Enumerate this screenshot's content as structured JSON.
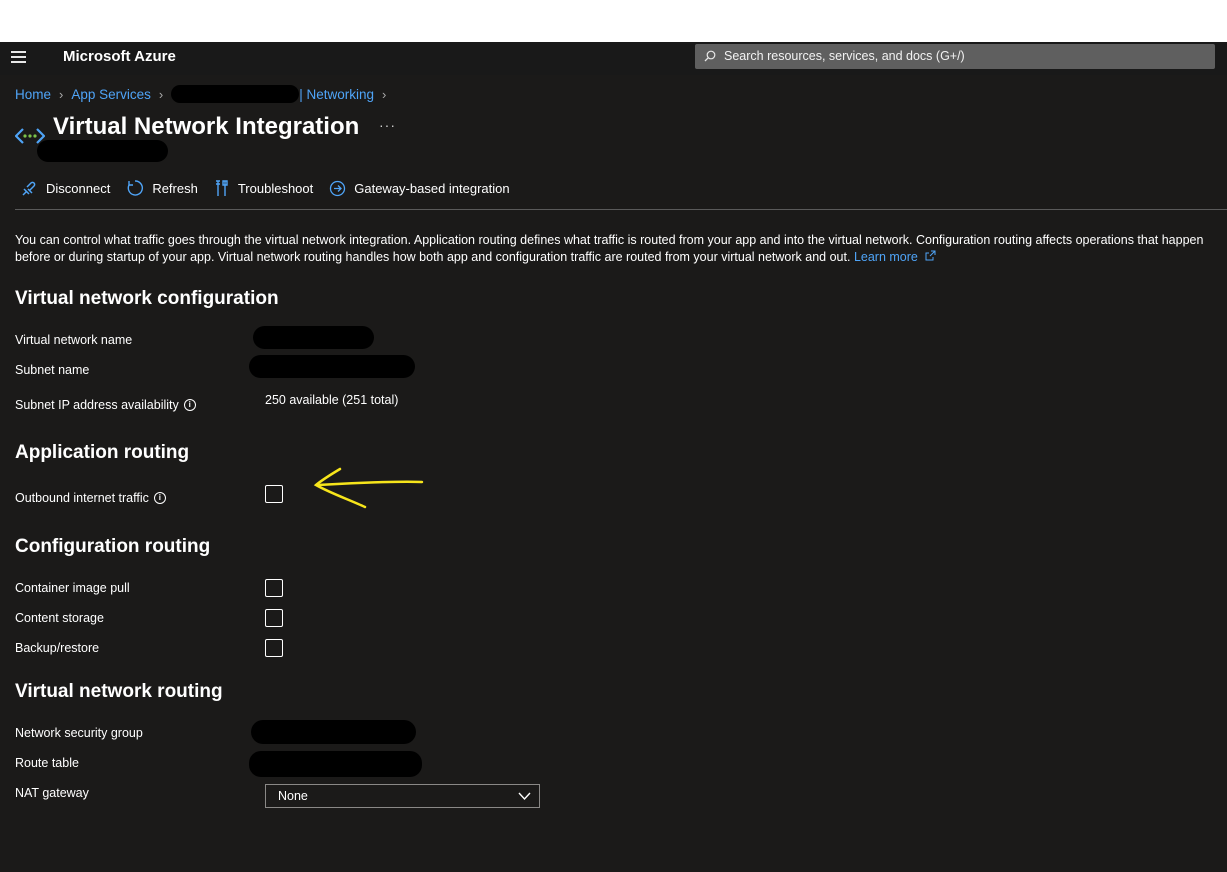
{
  "topbar": {
    "brand": "Microsoft Azure",
    "search_placeholder": "Search resources, services, and docs (G+/)"
  },
  "breadcrumb": {
    "home": "Home",
    "app_services": "App Services",
    "networking": "| Networking"
  },
  "page": {
    "title": "Virtual Network Integration",
    "more": "···"
  },
  "commands": {
    "disconnect": "Disconnect",
    "refresh": "Refresh",
    "troubleshoot": "Troubleshoot",
    "gateway": "Gateway-based integration"
  },
  "description": {
    "text": "You can control what traffic goes through the virtual network integration. Application routing defines what traffic is routed from your app and into the virtual network. Configuration routing affects operations that happen before or during startup of your app. Virtual network routing handles how both app and configuration traffic are routed from your virtual network and out.",
    "learn_more": "Learn more"
  },
  "vnet_config": {
    "heading": "Virtual network configuration",
    "vnet_name_label": "Virtual network name",
    "subnet_name_label": "Subnet name",
    "ip_label": "Subnet IP address availability",
    "ip_value": "250 available (251 total)"
  },
  "app_routing": {
    "heading": "Application routing",
    "outbound_label": "Outbound internet traffic",
    "outbound_checked": false
  },
  "config_routing": {
    "heading": "Configuration routing",
    "container_label": "Container image pull",
    "content_label": "Content storage",
    "backup_label": "Backup/restore"
  },
  "vnet_routing": {
    "heading": "Virtual network routing",
    "nsg_label": "Network security group",
    "route_label": "Route table",
    "nat_label": "NAT gateway",
    "nat_value": "None"
  },
  "colors": {
    "accent": "#4fa4f7",
    "annotation_arrow": "#f7e51b"
  }
}
